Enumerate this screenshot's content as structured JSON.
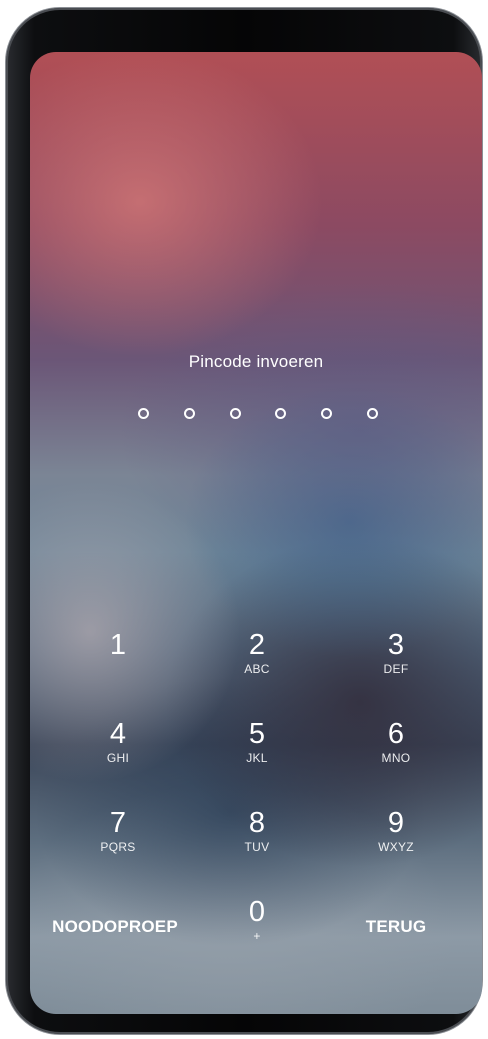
{
  "lock_screen": {
    "prompt": "Pincode invoeren",
    "pin_length": 6
  },
  "keypad": {
    "keys": [
      {
        "digit": "1",
        "letters": ""
      },
      {
        "digit": "2",
        "letters": "ABC"
      },
      {
        "digit": "3",
        "letters": "DEF"
      },
      {
        "digit": "4",
        "letters": "GHI"
      },
      {
        "digit": "5",
        "letters": "JKL"
      },
      {
        "digit": "6",
        "letters": "MNO"
      },
      {
        "digit": "7",
        "letters": "PQRS"
      },
      {
        "digit": "8",
        "letters": "TUV"
      },
      {
        "digit": "9",
        "letters": "WXYZ"
      },
      {
        "digit": "0",
        "letters": "+"
      }
    ],
    "emergency_label": "NOODOPROEP",
    "back_label": "TERUG"
  }
}
